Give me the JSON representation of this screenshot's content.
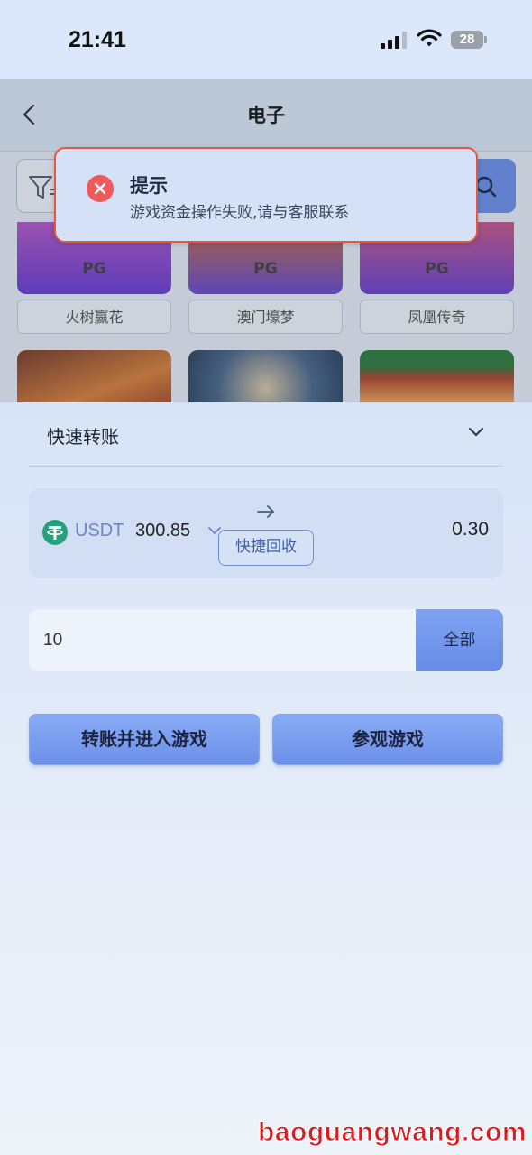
{
  "status_bar": {
    "time": "21:41",
    "battery": "28"
  },
  "nav": {
    "title": "电子"
  },
  "games": [
    {
      "badge": "PG",
      "name": "火树赢花"
    },
    {
      "badge": "PG",
      "name": "澳门壕梦"
    },
    {
      "badge": "PG",
      "name": "凤凰传奇"
    }
  ],
  "toast": {
    "title": "提示",
    "message": "游戏资金操作失败,请与客服联系"
  },
  "sheet": {
    "title": "快速转账",
    "transfer": {
      "currency": "USDT",
      "balance": "300.85",
      "recover_label": "快捷回收",
      "target_balance": "0.30"
    },
    "amount": {
      "value": "10",
      "all_label": "全部"
    },
    "buttons": {
      "transfer_enter": "转账并进入游戏",
      "view_game": "参观游戏"
    }
  },
  "watermark": "baoguangwang.com",
  "colors": {
    "accent": "#6e93ea",
    "error": "#e3583f",
    "usdt": "#26a17b"
  }
}
